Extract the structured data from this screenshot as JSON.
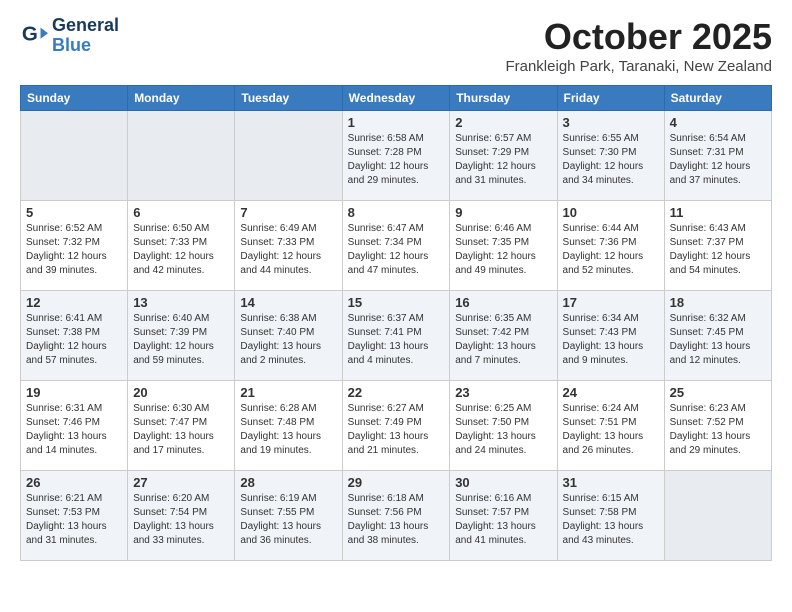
{
  "header": {
    "logo_line1": "General",
    "logo_line2": "Blue",
    "month": "October 2025",
    "location": "Frankleigh Park, Taranaki, New Zealand"
  },
  "weekdays": [
    "Sunday",
    "Monday",
    "Tuesday",
    "Wednesday",
    "Thursday",
    "Friday",
    "Saturday"
  ],
  "weeks": [
    [
      {
        "day": "",
        "info": ""
      },
      {
        "day": "",
        "info": ""
      },
      {
        "day": "",
        "info": ""
      },
      {
        "day": "1",
        "info": "Sunrise: 6:58 AM\nSunset: 7:28 PM\nDaylight: 12 hours\nand 29 minutes."
      },
      {
        "day": "2",
        "info": "Sunrise: 6:57 AM\nSunset: 7:29 PM\nDaylight: 12 hours\nand 31 minutes."
      },
      {
        "day": "3",
        "info": "Sunrise: 6:55 AM\nSunset: 7:30 PM\nDaylight: 12 hours\nand 34 minutes."
      },
      {
        "day": "4",
        "info": "Sunrise: 6:54 AM\nSunset: 7:31 PM\nDaylight: 12 hours\nand 37 minutes."
      }
    ],
    [
      {
        "day": "5",
        "info": "Sunrise: 6:52 AM\nSunset: 7:32 PM\nDaylight: 12 hours\nand 39 minutes."
      },
      {
        "day": "6",
        "info": "Sunrise: 6:50 AM\nSunset: 7:33 PM\nDaylight: 12 hours\nand 42 minutes."
      },
      {
        "day": "7",
        "info": "Sunrise: 6:49 AM\nSunset: 7:33 PM\nDaylight: 12 hours\nand 44 minutes."
      },
      {
        "day": "8",
        "info": "Sunrise: 6:47 AM\nSunset: 7:34 PM\nDaylight: 12 hours\nand 47 minutes."
      },
      {
        "day": "9",
        "info": "Sunrise: 6:46 AM\nSunset: 7:35 PM\nDaylight: 12 hours\nand 49 minutes."
      },
      {
        "day": "10",
        "info": "Sunrise: 6:44 AM\nSunset: 7:36 PM\nDaylight: 12 hours\nand 52 minutes."
      },
      {
        "day": "11",
        "info": "Sunrise: 6:43 AM\nSunset: 7:37 PM\nDaylight: 12 hours\nand 54 minutes."
      }
    ],
    [
      {
        "day": "12",
        "info": "Sunrise: 6:41 AM\nSunset: 7:38 PM\nDaylight: 12 hours\nand 57 minutes."
      },
      {
        "day": "13",
        "info": "Sunrise: 6:40 AM\nSunset: 7:39 PM\nDaylight: 12 hours\nand 59 minutes."
      },
      {
        "day": "14",
        "info": "Sunrise: 6:38 AM\nSunset: 7:40 PM\nDaylight: 13 hours\nand 2 minutes."
      },
      {
        "day": "15",
        "info": "Sunrise: 6:37 AM\nSunset: 7:41 PM\nDaylight: 13 hours\nand 4 minutes."
      },
      {
        "day": "16",
        "info": "Sunrise: 6:35 AM\nSunset: 7:42 PM\nDaylight: 13 hours\nand 7 minutes."
      },
      {
        "day": "17",
        "info": "Sunrise: 6:34 AM\nSunset: 7:43 PM\nDaylight: 13 hours\nand 9 minutes."
      },
      {
        "day": "18",
        "info": "Sunrise: 6:32 AM\nSunset: 7:45 PM\nDaylight: 13 hours\nand 12 minutes."
      }
    ],
    [
      {
        "day": "19",
        "info": "Sunrise: 6:31 AM\nSunset: 7:46 PM\nDaylight: 13 hours\nand 14 minutes."
      },
      {
        "day": "20",
        "info": "Sunrise: 6:30 AM\nSunset: 7:47 PM\nDaylight: 13 hours\nand 17 minutes."
      },
      {
        "day": "21",
        "info": "Sunrise: 6:28 AM\nSunset: 7:48 PM\nDaylight: 13 hours\nand 19 minutes."
      },
      {
        "day": "22",
        "info": "Sunrise: 6:27 AM\nSunset: 7:49 PM\nDaylight: 13 hours\nand 21 minutes."
      },
      {
        "day": "23",
        "info": "Sunrise: 6:25 AM\nSunset: 7:50 PM\nDaylight: 13 hours\nand 24 minutes."
      },
      {
        "day": "24",
        "info": "Sunrise: 6:24 AM\nSunset: 7:51 PM\nDaylight: 13 hours\nand 26 minutes."
      },
      {
        "day": "25",
        "info": "Sunrise: 6:23 AM\nSunset: 7:52 PM\nDaylight: 13 hours\nand 29 minutes."
      }
    ],
    [
      {
        "day": "26",
        "info": "Sunrise: 6:21 AM\nSunset: 7:53 PM\nDaylight: 13 hours\nand 31 minutes."
      },
      {
        "day": "27",
        "info": "Sunrise: 6:20 AM\nSunset: 7:54 PM\nDaylight: 13 hours\nand 33 minutes."
      },
      {
        "day": "28",
        "info": "Sunrise: 6:19 AM\nSunset: 7:55 PM\nDaylight: 13 hours\nand 36 minutes."
      },
      {
        "day": "29",
        "info": "Sunrise: 6:18 AM\nSunset: 7:56 PM\nDaylight: 13 hours\nand 38 minutes."
      },
      {
        "day": "30",
        "info": "Sunrise: 6:16 AM\nSunset: 7:57 PM\nDaylight: 13 hours\nand 41 minutes."
      },
      {
        "day": "31",
        "info": "Sunrise: 6:15 AM\nSunset: 7:58 PM\nDaylight: 13 hours\nand 43 minutes."
      },
      {
        "day": "",
        "info": ""
      }
    ]
  ]
}
